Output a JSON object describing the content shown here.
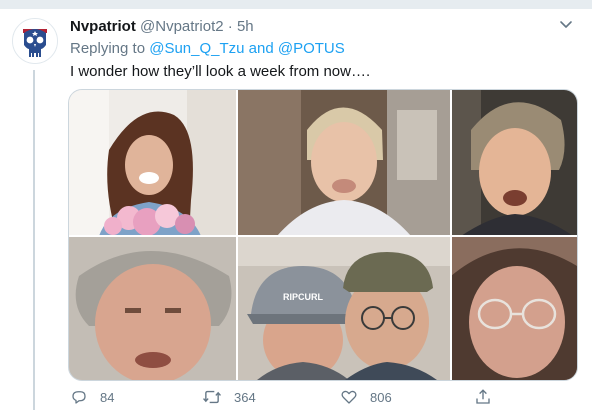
{
  "tweet": {
    "display_name": "Nvpatriot",
    "handle": "@Nvpatriot2",
    "separator": "·",
    "timestamp": "5h",
    "replying_prefix": "Replying to",
    "mention_1": "@Sun_Q_Tzu",
    "conjunction": "and",
    "mention_2": "@POTUS",
    "text": "I wonder how they’ll look a week from now…."
  },
  "media": {
    "tiles": [
      {
        "name": "video-tile-1"
      },
      {
        "name": "video-tile-2"
      },
      {
        "name": "video-tile-3"
      },
      {
        "name": "video-tile-4"
      },
      {
        "name": "video-tile-5",
        "cap_text": "RIPCURL"
      },
      {
        "name": "video-tile-6"
      }
    ]
  },
  "actions": {
    "reply_count": "84",
    "retweet_count": "364",
    "like_count": "806"
  },
  "colors": {
    "accent": "#1da1f2",
    "muted": "#657786",
    "text": "#14171a",
    "border": "#e6ecf0"
  },
  "icons": [
    "skull-avatar-icon",
    "chevron-down-icon",
    "reply-icon",
    "retweet-icon",
    "like-icon",
    "share-icon"
  ]
}
